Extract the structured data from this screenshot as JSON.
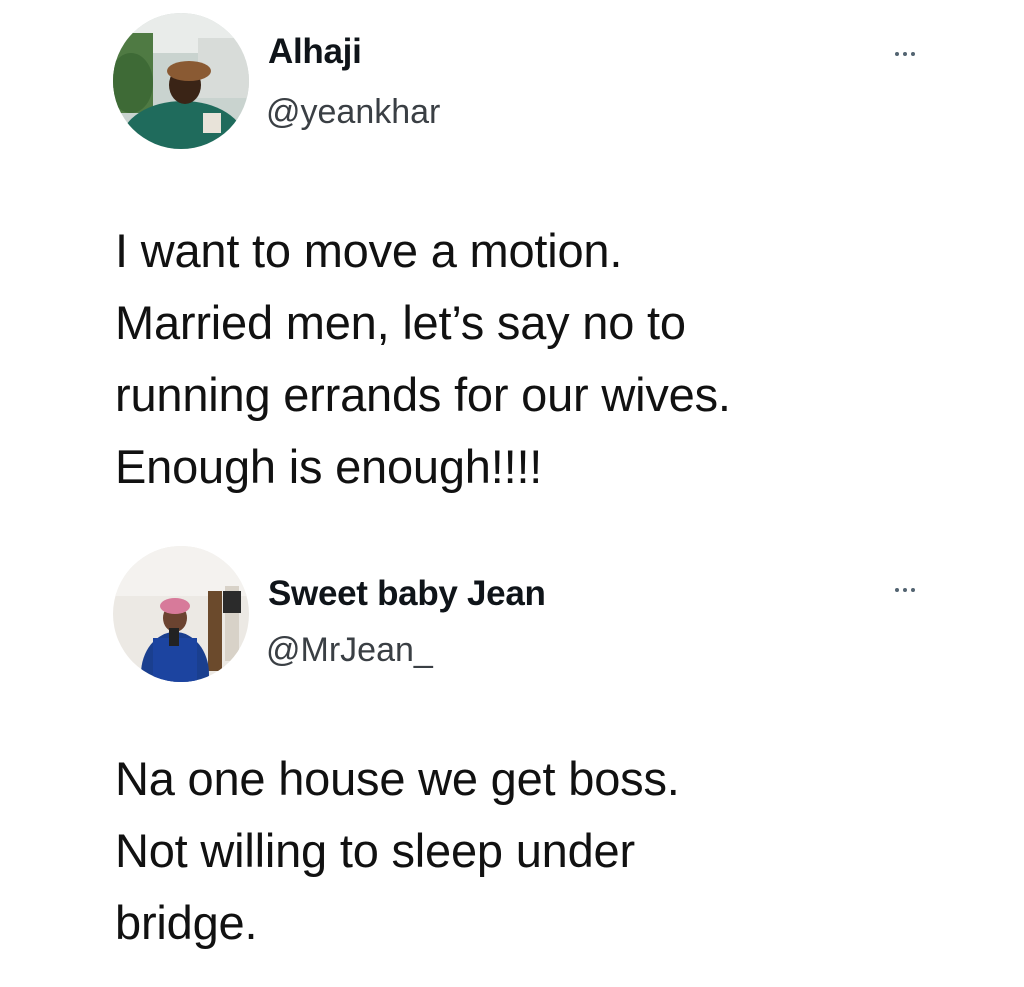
{
  "tweets": [
    {
      "author_name": "Alhaji",
      "author_handle": "@yeankhar",
      "avatar_icon": "profile-photo-icon",
      "more_icon": "more-options-icon",
      "text": "I want to move a motion.\nMarried men, let’s say no to\nrunning errands for our wives.\nEnough is enough!!!!"
    },
    {
      "author_name": "Sweet baby Jean",
      "author_handle": "@MrJean_",
      "avatar_icon": "profile-photo-icon",
      "more_icon": "more-options-icon",
      "text": "Na one house we get boss.\nNot willing to sleep under\nbridge."
    }
  ],
  "colors": {
    "background": "#ffffff",
    "text_primary": "#111111",
    "text_secondary": "#3a3f44",
    "icon_gray": "#536471"
  }
}
